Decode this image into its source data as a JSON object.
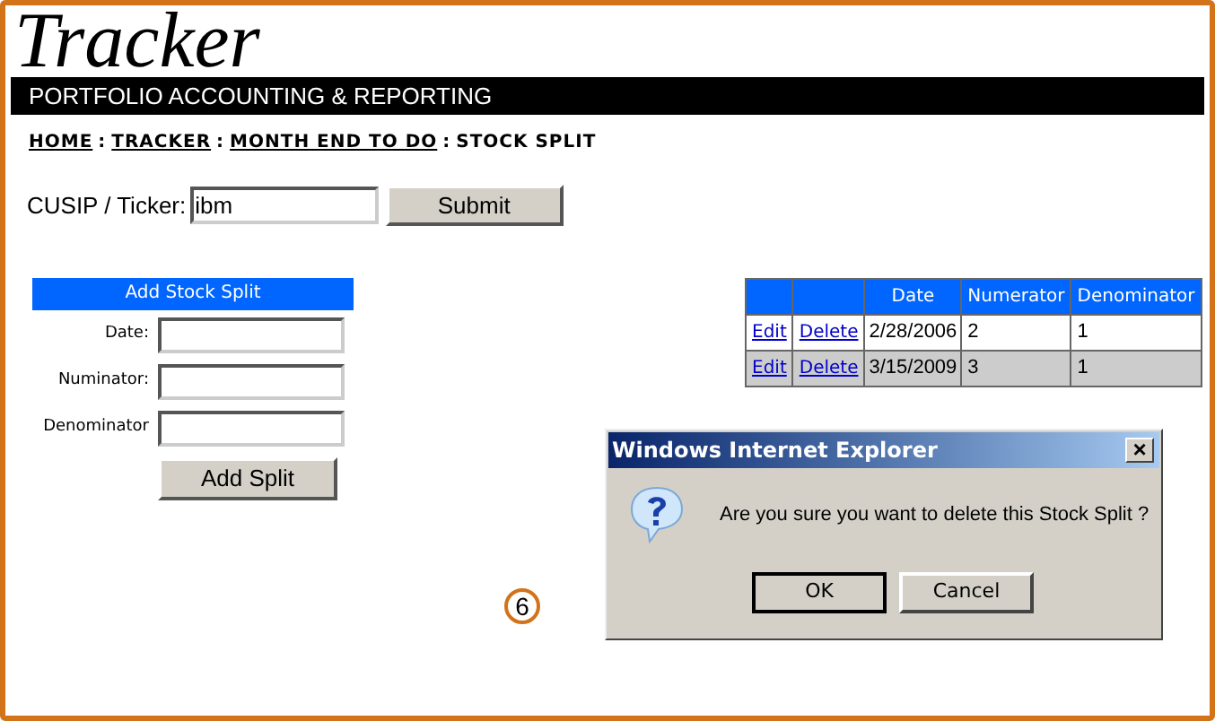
{
  "logo": "Tracker",
  "banner": "PORTFOLIO ACCOUNTING & REPORTING",
  "breadcrumb_separator": ":",
  "breadcrumb": [
    {
      "label": "HOME",
      "link": true
    },
    {
      "label": "TRACKER",
      "link": true
    },
    {
      "label": "MONTH END TO DO",
      "link": true
    },
    {
      "label": "STOCK SPLIT",
      "link": false
    }
  ],
  "lookup": {
    "label": "CUSIP / Ticker:",
    "value": "ibm",
    "button": "Submit"
  },
  "add_form": {
    "title": "Add Stock Split",
    "fields": [
      {
        "label": "Date:"
      },
      {
        "label": "Numinator:"
      },
      {
        "label": "Denominator"
      }
    ],
    "button": "Add Split"
  },
  "table": {
    "columns": [
      "",
      "",
      "Date",
      "Numerator",
      "Denominator"
    ],
    "rows": [
      {
        "edit": "Edit",
        "delete": "Delete",
        "date": "2/28/2006",
        "numerator": "2",
        "denominator": "1"
      },
      {
        "edit": "Edit",
        "delete": "Delete",
        "date": "3/15/2009",
        "numerator": "3",
        "denominator": "1"
      }
    ]
  },
  "dialog": {
    "title": "Windows Internet Explorer",
    "close": "×",
    "message": "Are you sure you want to delete this Stock Split ?",
    "buttons": [
      "OK",
      "Cancel"
    ]
  },
  "step_marker": "6"
}
